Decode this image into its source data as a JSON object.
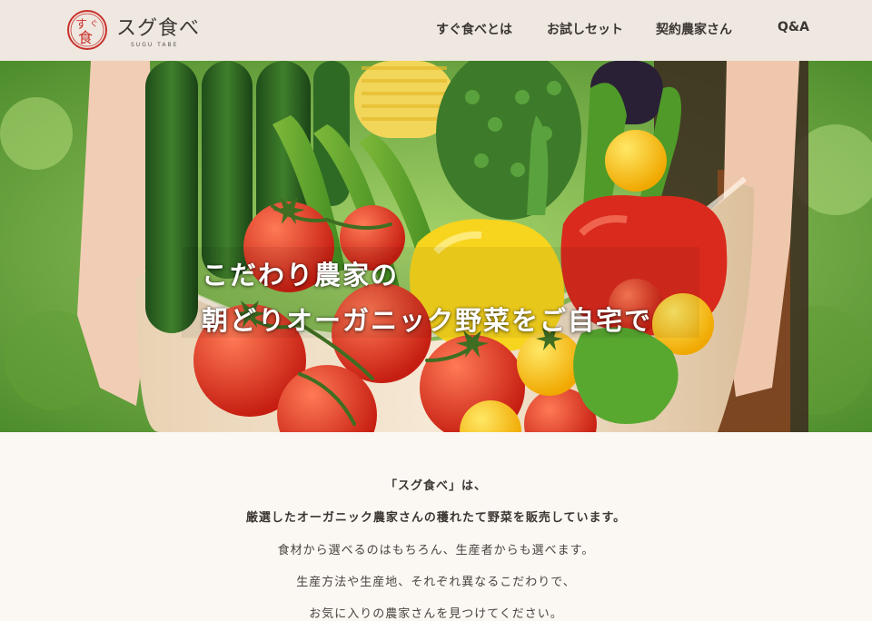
{
  "brand": {
    "name": "スグ食べ",
    "sub": "SUGU TABE",
    "mark_text": "すぐ食",
    "accent_color": "#c8312b"
  },
  "nav": {
    "items": [
      {
        "label": "すぐ食べとは"
      },
      {
        "label": "お試しセット"
      },
      {
        "label": "契約農家さん"
      },
      {
        "label": "Q&A"
      }
    ]
  },
  "hero": {
    "headline_line1": "こだわり農家の",
    "headline_line2": "朝どりオーガニック野菜をご自宅で"
  },
  "intro": {
    "lines": [
      "「スグ食べ」は、",
      "厳選したオーガニック農家さんの穫れたて野菜を販売しています。",
      "食材から選べるのはもちろん、生産者からも選べます。",
      "生産方法や生産地、それぞれ異なるこだわりで、",
      "お気に入りの農家さんを見つけてください。"
    ]
  }
}
